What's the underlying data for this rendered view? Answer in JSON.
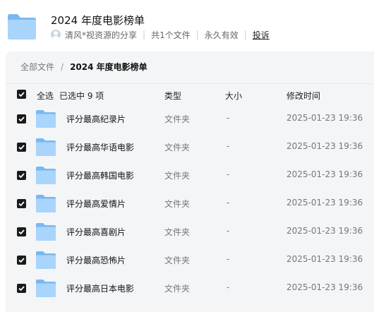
{
  "share": {
    "title": "2024 年度电影榜单",
    "owner": "清风*视资源的分享",
    "file_count": "共1个文件",
    "validity": "永久有效",
    "report_label": "投诉"
  },
  "breadcrumb": {
    "root": "全部文件",
    "current": "2024 年度电影榜单"
  },
  "table": {
    "select_all_label": "全选",
    "selected_text": "已选中 9 项",
    "columns": {
      "type": "类型",
      "size": "大小",
      "modified": "修改时间"
    },
    "rows": [
      {
        "name": "评分最高纪录片",
        "type": "文件夹",
        "size": "-",
        "modified": "2025-01-23 19:36"
      },
      {
        "name": "评分最高华语电影",
        "type": "文件夹",
        "size": "-",
        "modified": "2025-01-23 19:36"
      },
      {
        "name": "评分最高韩国电影",
        "type": "文件夹",
        "size": "-",
        "modified": "2025-01-23 19:36"
      },
      {
        "name": "评分最高爱情片",
        "type": "文件夹",
        "size": "-",
        "modified": "2025-01-23 19:36"
      },
      {
        "name": "评分最高喜剧片",
        "type": "文件夹",
        "size": "-",
        "modified": "2025-01-23 19:36"
      },
      {
        "name": "评分最高恐怖片",
        "type": "文件夹",
        "size": "-",
        "modified": "2025-01-23 19:36"
      },
      {
        "name": "评分最高日本电影",
        "type": "文件夹",
        "size": "-",
        "modified": "2025-01-23 19:36"
      }
    ]
  },
  "icons": {
    "folder": "folder-icon",
    "checkbox": "checkbox-checked-icon",
    "avatar": "user-avatar-icon"
  },
  "colors": {
    "folder_light": "#a9d4fb",
    "folder_dark": "#78b8f2",
    "checkbox": "#1a1a1a",
    "panel_bg": "#f4f5f7"
  }
}
